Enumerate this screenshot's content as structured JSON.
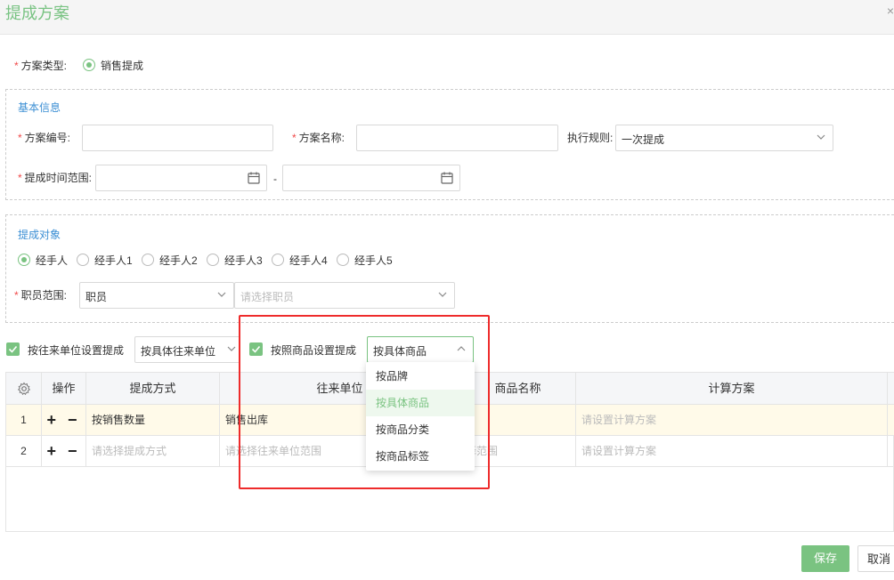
{
  "dialog": {
    "title": "提成方案",
    "close_glyph": "×"
  },
  "scheme_type": {
    "label": "方案类型:",
    "option": "销售提成"
  },
  "basic": {
    "legend": "基本信息",
    "code_label": "方案编号:",
    "name_label": "方案名称:",
    "rule_label": "执行规则:",
    "rule_value": "一次提成",
    "time_label": "提成时间范围:",
    "range_sep": "-"
  },
  "target": {
    "legend": "提成对象",
    "handlers": [
      "经手人",
      "经手人1",
      "经手人2",
      "经手人3",
      "经手人4",
      "经手人5"
    ],
    "staff_label": "职员范围:",
    "staff_type": "职员",
    "staff_placeholder": "请选择职员"
  },
  "options_bar": {
    "by_unit_label": "按往来单位设置提成",
    "by_unit_value": "按具体往来单位",
    "by_goods_label": "按照商品设置提成",
    "by_goods_value": "按具体商品"
  },
  "table": {
    "headers": [
      "操作",
      "提成方式",
      "往来单位",
      "商品名称",
      "计算方案"
    ],
    "rows": [
      {
        "index": "1",
        "ops": "+ −",
        "method": "按销售数量",
        "unit": "销售出库",
        "goods": "",
        "calc": "请设置计算方案"
      },
      {
        "index": "2",
        "ops": "+ −",
        "method": "请选择提成方式",
        "unit": "请选择往来单位范围",
        "goods": "择范围",
        "calc": "请设置计算方案"
      }
    ]
  },
  "dropdown": {
    "options": [
      "按品牌",
      "按具体商品",
      "按商品分类",
      "按商品标签"
    ],
    "selected": "按具体商品"
  },
  "footer": {
    "save": "保存",
    "cancel": "取消"
  },
  "colors": {
    "accent": "#7ac381",
    "highlight_box": "#ee2b2b",
    "legend_blue": "#3c8fd4"
  }
}
